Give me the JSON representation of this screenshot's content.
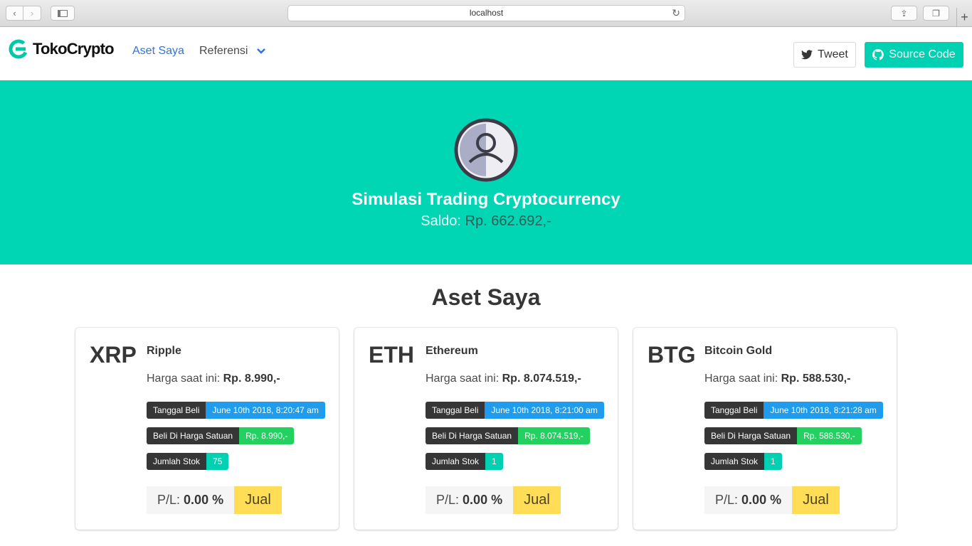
{
  "browser": {
    "url": "localhost"
  },
  "navbar": {
    "brand": "TokoCrypto",
    "links": [
      {
        "label": "Aset Saya"
      },
      {
        "label": "Referensi"
      }
    ],
    "tweet_label": "Tweet",
    "source_label": "Source Code"
  },
  "hero": {
    "title": "Simulasi Trading Cryptocurrency",
    "saldo_label": "Saldo:",
    "saldo_value": "Rp. 662.692,-"
  },
  "section": {
    "title": "Aset Saya"
  },
  "labels": {
    "price": "Harga saat ini:",
    "tanggal_beli": "Tanggal Beli",
    "beli_harga": "Beli Di Harga Satuan",
    "jumlah_stok": "Jumlah Stok",
    "pl": "P/L:",
    "jual": "Jual"
  },
  "assets": [
    {
      "symbol": "XRP",
      "name": "Ripple",
      "price": "Rp. 8.990,-",
      "tanggal": "June 10th 2018, 8:20:47 am",
      "beli_harga": "Rp. 8.990,-",
      "stok": "75",
      "pl": "0.00 %"
    },
    {
      "symbol": "ETH",
      "name": "Ethereum",
      "price": "Rp. 8.074.519,-",
      "tanggal": "June 10th 2018, 8:21:00 am",
      "beli_harga": "Rp. 8.074.519,-",
      "stok": "1",
      "pl": "0.00 %"
    },
    {
      "symbol": "BTG",
      "name": "Bitcoin Gold",
      "price": "Rp. 588.530,-",
      "tanggal": "June 10th 2018, 8:21:28 am",
      "beli_harga": "Rp. 588.530,-",
      "stok": "1",
      "pl": "0.00 %"
    }
  ],
  "colors": {
    "primary": "#00d1b2",
    "link": "#3273dc",
    "info": "#209cee",
    "success": "#23d160",
    "warning": "#ffdd57",
    "dark": "#363636"
  }
}
